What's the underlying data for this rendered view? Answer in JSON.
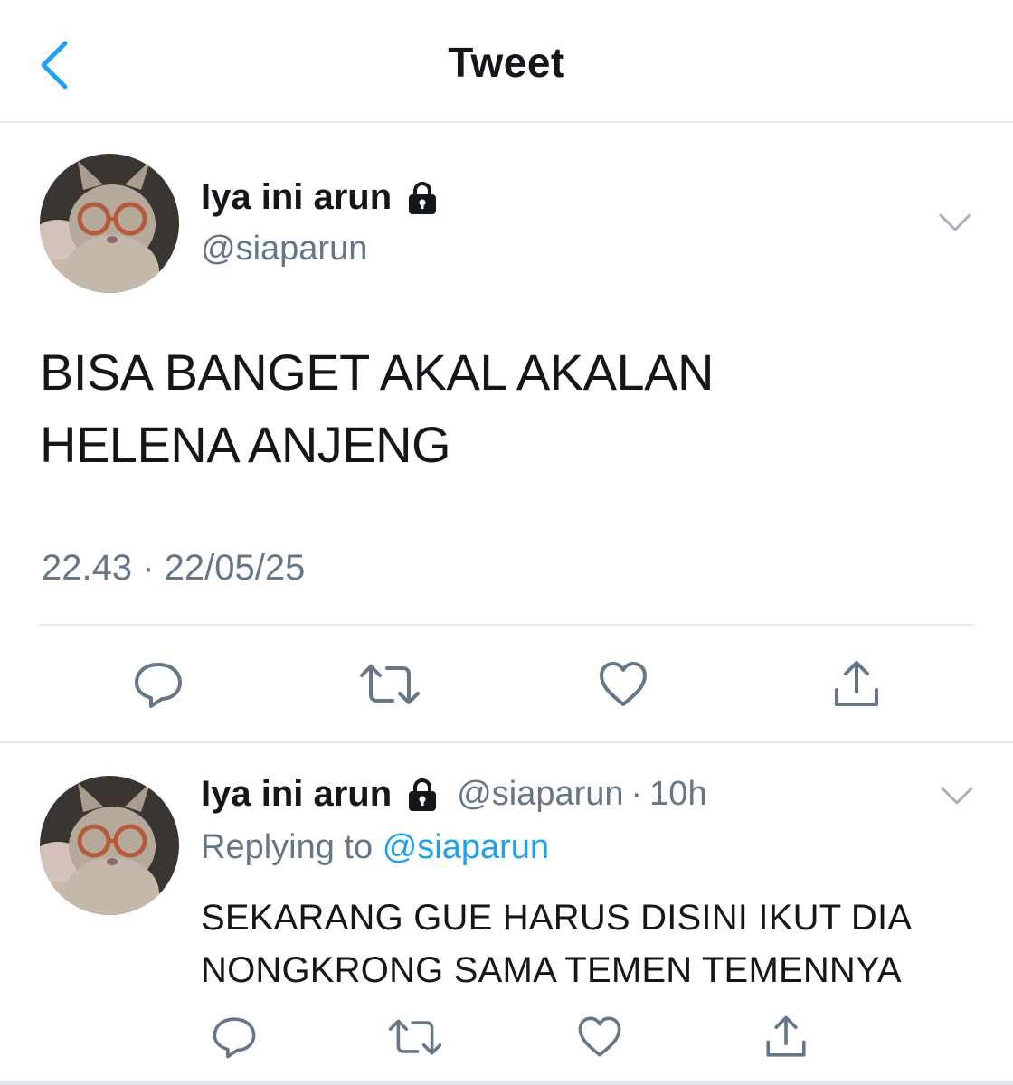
{
  "header": {
    "title": "Tweet",
    "back_icon": "chevron-left-icon"
  },
  "colors": {
    "accent": "#1da1f2",
    "secondary_text": "#657786",
    "primary_text": "#14171a",
    "divider": "#e1e8ed"
  },
  "tweet": {
    "display_name": "Iya ini arun",
    "handle": "@siaparun",
    "text_lines": [
      "BISA BANGET AKAL AKALAN",
      "HELENA ANJENG"
    ],
    "timestamp": "22.43 · 22/05/25",
    "actions": [
      "reply-icon",
      "retweet-icon",
      "like-icon",
      "share-icon"
    ]
  },
  "reply": {
    "display_name": "Iya ini arun",
    "handle": "@siaparun",
    "separator": "·",
    "time": "10h",
    "replying_prefix": "Replying to",
    "replying_handle": "@siaparun",
    "text_lines": [
      "SEKARANG GUE HARUS DISINI IKUT DIA",
      "NONGKRONG SAMA TEMEN TEMENNYA"
    ],
    "actions": [
      "reply-icon",
      "retweet-icon",
      "like-icon",
      "share-icon"
    ]
  }
}
